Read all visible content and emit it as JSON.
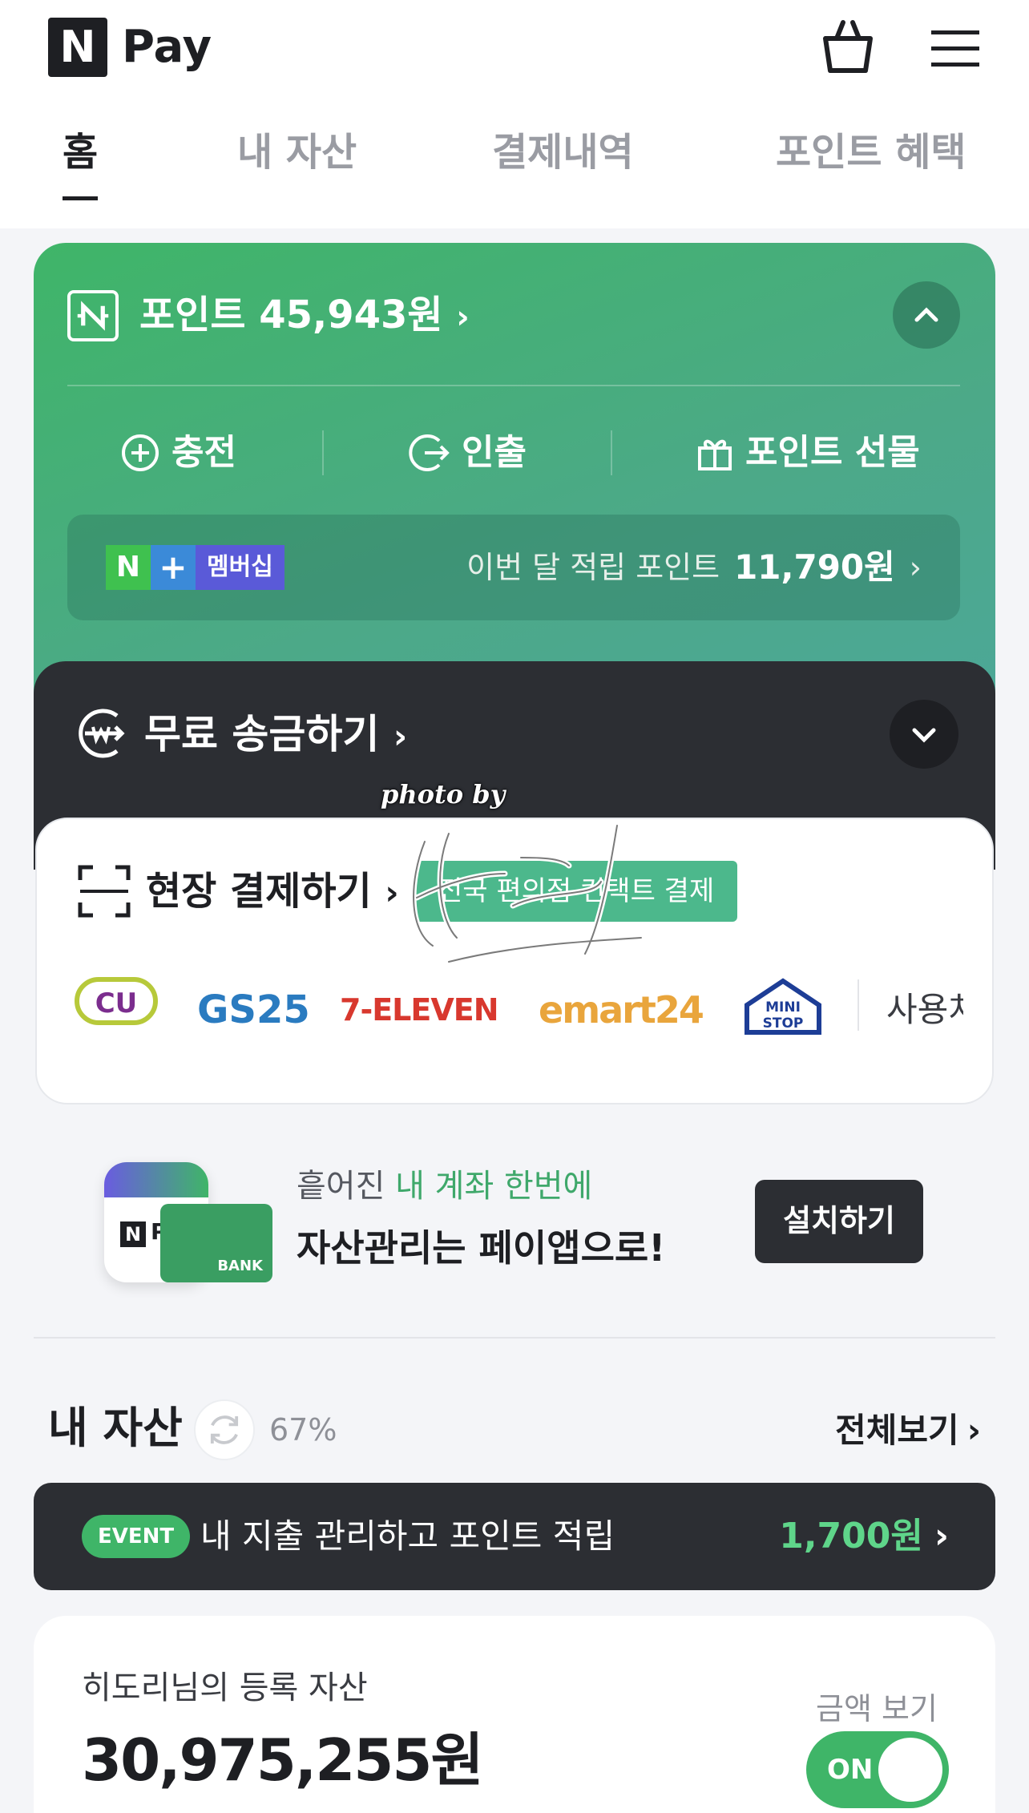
{
  "header": {
    "logo_letter": "N",
    "app_name": "Pay",
    "cart_icon": "shopping-bag-icon",
    "menu_icon": "hamburger-menu-icon"
  },
  "tabs": [
    {
      "label": "홈",
      "active": true
    },
    {
      "label": "내 자산",
      "active": false
    },
    {
      "label": "결제내역",
      "active": false
    },
    {
      "label": "포인트 혜택",
      "active": false
    }
  ],
  "points": {
    "title": "포인트 45,943원",
    "actions": [
      {
        "label": "충전",
        "icon": "plus-circle-icon"
      },
      {
        "label": "인출",
        "icon": "withdraw-icon"
      },
      {
        "label": "포인트 선물",
        "icon": "gift-icon"
      }
    ],
    "membership": {
      "badge_n": "N",
      "badge_plus": "+",
      "badge_label": "멤버십",
      "monthly_label": "이번 달 적립 포인트",
      "monthly_amount": "11,790원"
    }
  },
  "transfer": {
    "title": "무료 송금하기"
  },
  "watermark": {
    "text": "photo by"
  },
  "onsite": {
    "title": "현장 결제하기",
    "badge": "전국 편의점 컨택트 결제",
    "stores": [
      "CU",
      "GS25",
      "7-ELEVEN",
      "emart24",
      "MINI STOP"
    ],
    "more": "사용처"
  },
  "banner": {
    "line1_prefix": "흩어진 ",
    "line1_highlight": "내 계좌 한번에",
    "line2": "자산관리는 페이앱으로!",
    "app_label": "Pay",
    "app_letter": "N",
    "bank_label": "BANK",
    "install_button": "설치하기"
  },
  "assets": {
    "title": "내 자산",
    "sync_percent": "67%",
    "view_all": "전체보기"
  },
  "event": {
    "badge": "EVENT",
    "text": "내 지출 관리하고 포인트 적립",
    "amount": "1,700원"
  },
  "asset_card": {
    "label": "히도리님의 등록 자산",
    "amount": "30,975,255원",
    "toggle_label": "금액 보기",
    "toggle_state": "ON"
  },
  "colors": {
    "point_green": "#3fb568",
    "dark_card": "#2c2e33",
    "accent_green": "#5fd58a"
  }
}
